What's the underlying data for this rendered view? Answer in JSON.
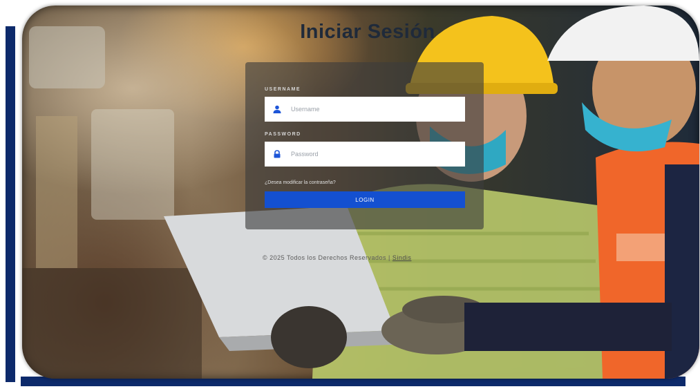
{
  "page": {
    "title": "Iniciar Sesión"
  },
  "login": {
    "username_label": "USERNAME",
    "username_placeholder": "Username",
    "password_label": "PASSWORD",
    "password_placeholder": "Password",
    "forgot_link": "¿Desea modificar la contraseña?",
    "login_button": "LOGIN"
  },
  "footer": {
    "text": "© 2025 Todos los Derechos Reservados | ",
    "link": "Sindis"
  },
  "icons": {
    "username": "user-icon",
    "password": "lock-icon"
  },
  "colors": {
    "frame": "#0d2a6b",
    "login_button": "#1450d0",
    "icon": "#1d55d8"
  }
}
